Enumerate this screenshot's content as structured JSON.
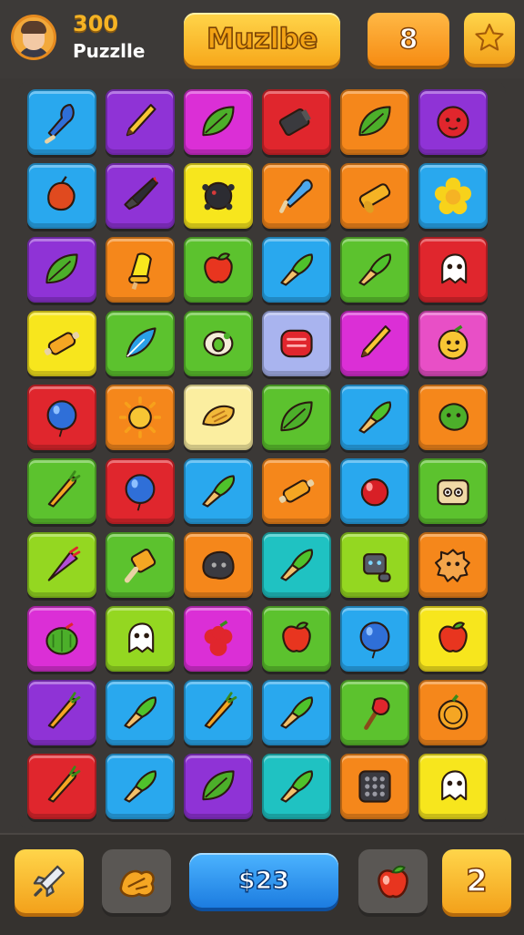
{
  "header": {
    "score": "300",
    "subtitle": "Puzzlle",
    "title": "Muzlbe",
    "moves": "8",
    "avatar_icon": "player-avatar",
    "star_icon": "star-icon"
  },
  "footer": {
    "coins": "$23",
    "count": "2",
    "left_icon": "rocket-icon",
    "leaf_icon": "leaf-cluster-icon",
    "fruit_icon": "apple-icon"
  },
  "palette": {
    "blue": "#29a8ee",
    "purple": "#8f33d6",
    "magenta": "#db2fd6",
    "red": "#e0262d",
    "orange": "#f5871b",
    "green": "#5cc22e",
    "yellow": "#f7e61d",
    "cream": "#fbeea0",
    "teal": "#1fc2c2",
    "lavender": "#a9b4ef",
    "lime": "#94d721",
    "pink": "#e84fc6"
  },
  "board": {
    "rows": [
      [
        [
          "blue",
          "drop-icon"
        ],
        [
          "purple",
          "pencil-icon"
        ],
        [
          "magenta",
          "leaf-icon"
        ],
        [
          "red",
          "battery-icon"
        ],
        [
          "orange",
          "leaf-icon"
        ],
        [
          "purple",
          "tomato-icon"
        ]
      ],
      [
        [
          "blue",
          "fruit-icon"
        ],
        [
          "purple",
          "rocket-icon"
        ],
        [
          "yellow",
          "mine-icon"
        ],
        [
          "orange",
          "pen-icon"
        ],
        [
          "orange",
          "cylinder-icon"
        ],
        [
          "blue",
          "flower-icon"
        ]
      ],
      [
        [
          "purple",
          "leaf-icon"
        ],
        [
          "orange",
          "bell-icon"
        ],
        [
          "green",
          "apple-icon"
        ],
        [
          "blue",
          "brush-icon"
        ],
        [
          "green",
          "brush-icon"
        ],
        [
          "red",
          "ghost-icon"
        ]
      ],
      [
        [
          "yellow",
          "rolling-pin-icon"
        ],
        [
          "green",
          "feather-icon"
        ],
        [
          "green",
          "ring-icon"
        ],
        [
          "lavender",
          "candy-icon"
        ],
        [
          "magenta",
          "pencil-icon"
        ],
        [
          "pink",
          "smiley-icon"
        ]
      ],
      [
        [
          "red",
          "balloon-icon"
        ],
        [
          "orange",
          "sun-icon"
        ],
        [
          "cream",
          "bread-icon"
        ],
        [
          "green",
          "leaf-icon"
        ],
        [
          "blue",
          "brush-icon"
        ],
        [
          "orange",
          "blob-icon"
        ]
      ],
      [
        [
          "green",
          "carrot-icon"
        ],
        [
          "red",
          "balloon-icon"
        ],
        [
          "blue",
          "brush-icon"
        ],
        [
          "orange",
          "rolling-pin-icon"
        ],
        [
          "blue",
          "cherry-icon"
        ],
        [
          "green",
          "biscuit-icon"
        ]
      ],
      [
        [
          "lime",
          "cone-icon"
        ],
        [
          "green",
          "paddle-icon"
        ],
        [
          "orange",
          "rock-icon"
        ],
        [
          "teal",
          "brush-icon"
        ],
        [
          "lime",
          "robot-icon"
        ],
        [
          "orange",
          "cookie-icon"
        ]
      ],
      [
        [
          "magenta",
          "melon-icon"
        ],
        [
          "lime",
          "ghost-icon"
        ],
        [
          "magenta",
          "berry-icon"
        ],
        [
          "green",
          "apple-icon"
        ],
        [
          "blue",
          "balloon-icon"
        ],
        [
          "yellow",
          "apple-icon"
        ]
      ],
      [
        [
          "purple",
          "carrot-icon"
        ],
        [
          "blue",
          "brush-icon"
        ],
        [
          "blue",
          "carrot-icon"
        ],
        [
          "blue",
          "brush-icon"
        ],
        [
          "green",
          "torch-icon"
        ],
        [
          "orange",
          "orange-icon"
        ]
      ],
      [
        [
          "red",
          "carrot-icon"
        ],
        [
          "blue",
          "brush-icon"
        ],
        [
          "purple",
          "leaf-icon"
        ],
        [
          "teal",
          "brush-icon"
        ],
        [
          "orange",
          "dice-icon"
        ],
        [
          "yellow",
          "ghost-icon"
        ]
      ]
    ]
  }
}
